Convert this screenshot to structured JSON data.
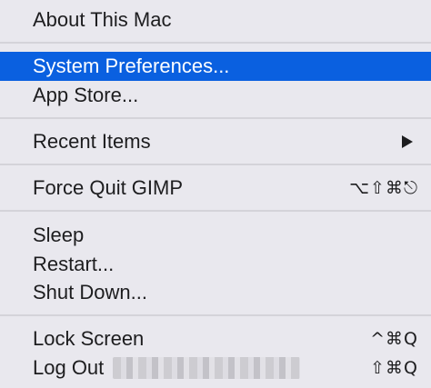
{
  "menu": {
    "about": "About This Mac",
    "system_preferences": "System Preferences...",
    "app_store": "App Store...",
    "recent_items": "Recent Items",
    "force_quit": "Force Quit GIMP",
    "force_quit_shortcut": "⌥⇧⌘⎋",
    "sleep": "Sleep",
    "restart": "Restart...",
    "shut_down": "Shut Down...",
    "lock_screen": "Lock Screen",
    "lock_screen_shortcut": "^⌘Q",
    "log_out": "Log Out",
    "log_out_shortcut": "⇧⌘Q"
  },
  "colors": {
    "background": "#e9e8ee",
    "highlight": "#0a60e0",
    "separator": "#d4d3d9",
    "text": "#1d1d1f"
  }
}
